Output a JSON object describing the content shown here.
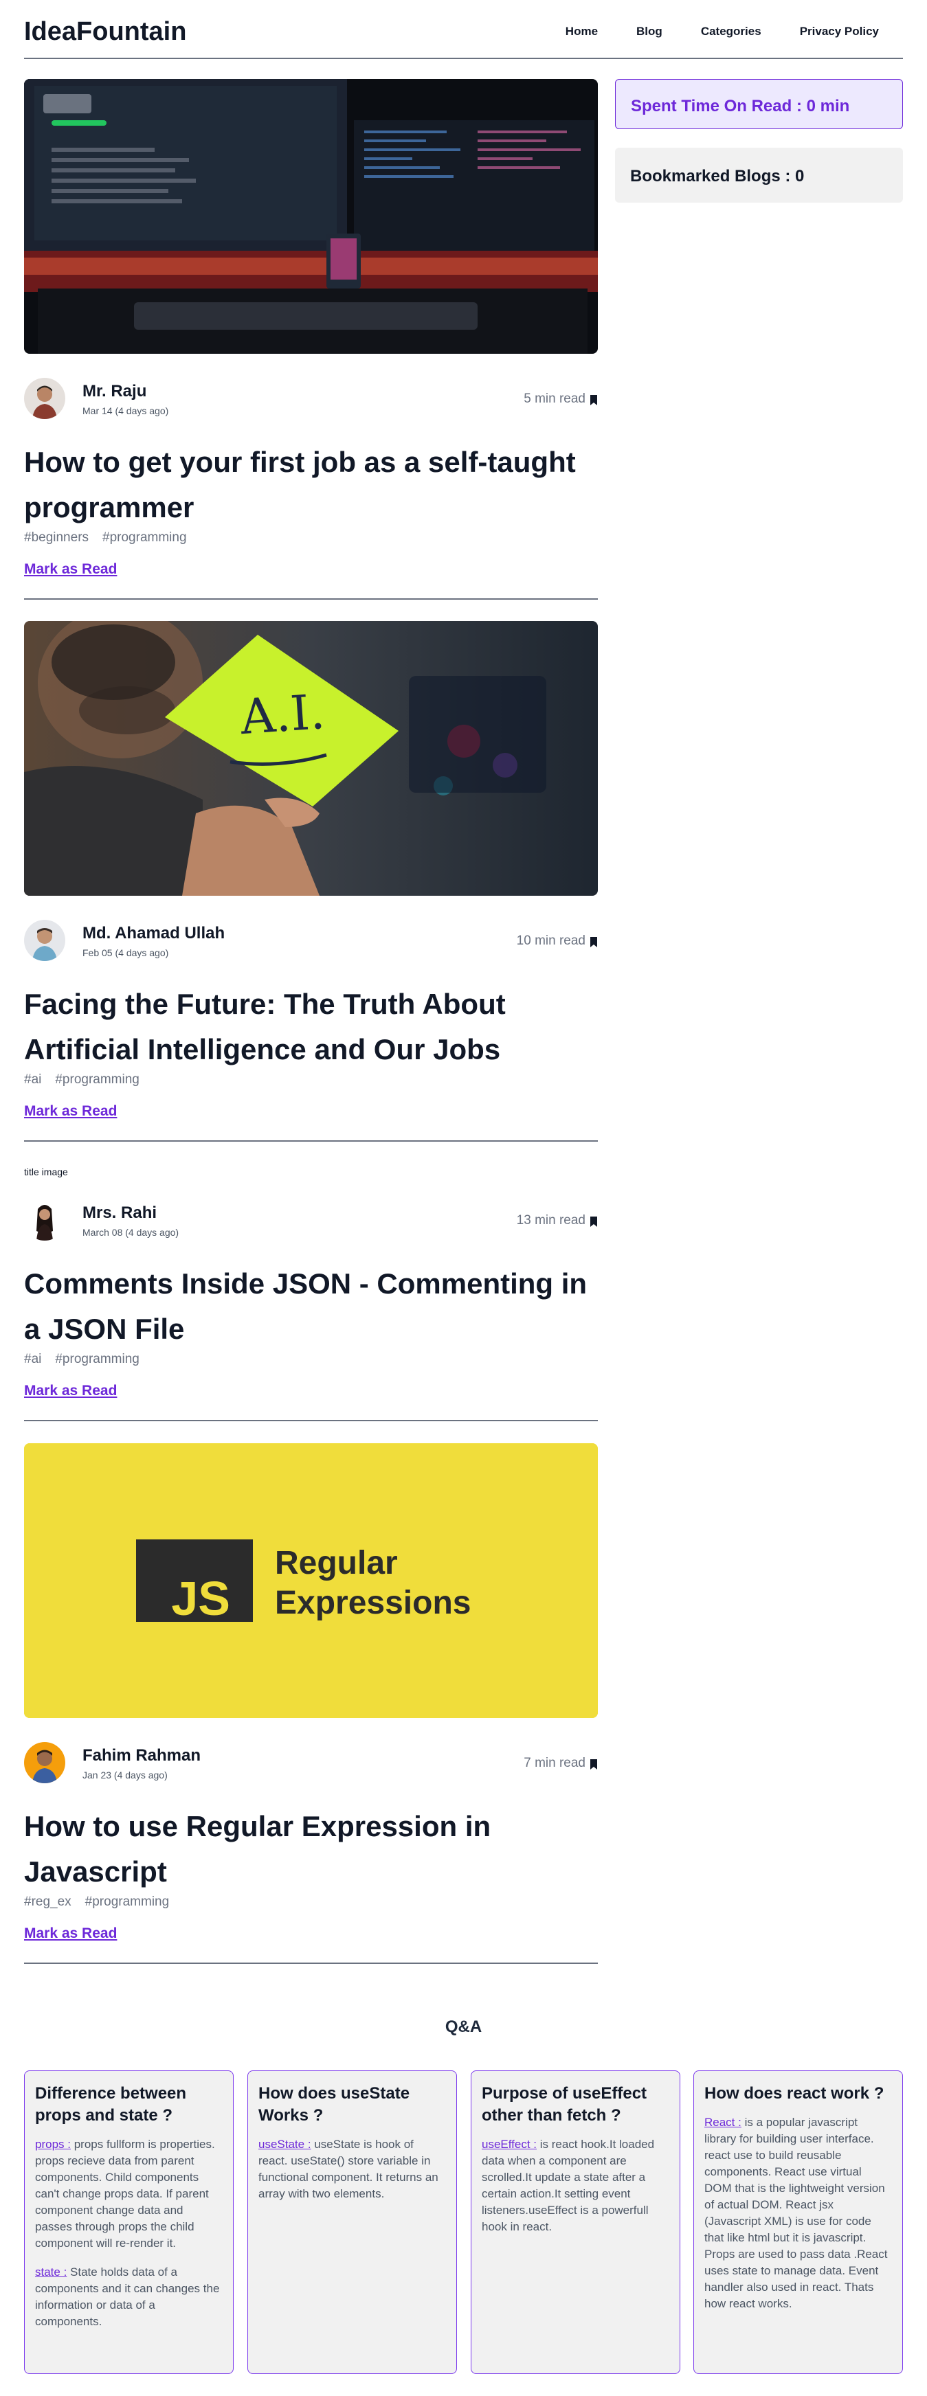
{
  "header": {
    "logo": "IdeaFountain",
    "nav": [
      "Home",
      "Blog",
      "Categories",
      "Privacy Policy"
    ]
  },
  "sidebar": {
    "spent_time": "Spent Time On Read : 0 min",
    "bookmarked": "Bookmarked Blogs : 0"
  },
  "blogs": [
    {
      "author": "Mr. Raju",
      "date": "Mar 14 (4 days ago)",
      "read_time": "5 min read",
      "title": "How to get your first job as a self-taught programmer",
      "tags": [
        "#beginners",
        "#programming"
      ],
      "mark_label": "Mark as Read"
    },
    {
      "author": "Md. Ahamad Ullah",
      "date": "Feb 05 (4 days ago)",
      "read_time": "10 min read",
      "title": "Facing the Future: The Truth About Artificial Intelligence and Our Jobs",
      "tags": [
        "#ai",
        "#programming"
      ],
      "mark_label": "Mark as Read",
      "cover_text": "A.I."
    },
    {
      "image_alt": "title image",
      "author": "Mrs. Rahi",
      "date": "March 08 (4 days ago)",
      "read_time": "13 min read",
      "title": "Comments Inside JSON - Commenting in a JSON File",
      "tags": [
        "#ai",
        "#programming"
      ],
      "mark_label": "Mark as Read"
    },
    {
      "author": "Fahim Rahman",
      "date": "Jan 23 (4 days ago)",
      "read_time": "7 min read",
      "title": "How to use Regular Expression in Javascript",
      "tags": [
        "#reg_ex",
        "#programming"
      ],
      "mark_label": "Mark as Read",
      "cover_badge": "JS",
      "cover_line1": "Regular",
      "cover_line2": "Expressions"
    }
  ],
  "qa": {
    "heading": "Q&A",
    "cards": [
      {
        "title": "Difference between props and state ?",
        "paras": [
          {
            "term": "props :",
            "text": " props fullform is properties. props recieve data from parent components. Child components can't change props data. If parent component change data and passes through props the child component will re-render it."
          },
          {
            "term": "state :",
            "text": " State holds data of a components and it can changes the information or data of a components."
          }
        ]
      },
      {
        "title": "How does useState Works ?",
        "paras": [
          {
            "term": "useState :",
            "text": " useState is hook of react. useState() store variable in functional component. It returns an array with two elements."
          }
        ]
      },
      {
        "title": "Purpose of useEffect other than fetch ?",
        "paras": [
          {
            "term": "useEffect :",
            "text": " is react hook.It loaded data when a component are scrolled.It update a state after a certain action.It setting event listeners.useEffect is a powerfull hook in react."
          }
        ]
      },
      {
        "title": "How does react work ?",
        "paras": [
          {
            "term": "React :",
            "text": " is a popular javascript library for building user interface. react use to build reusable components. React use virtual DOM that is the lightweight version of actual DOM. React jsx (Javascript XML) is use for code that like html but it is javascript. Props are used to pass data .React uses state to manage data. Event handler also used in react. Thats how react works."
          }
        ]
      }
    ]
  }
}
